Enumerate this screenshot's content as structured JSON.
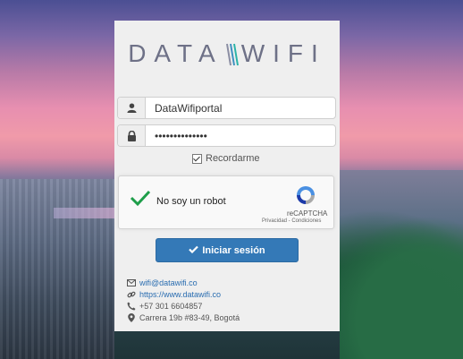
{
  "brand": {
    "logo_left": "DATA",
    "logo_right": "WIFI"
  },
  "login": {
    "username_value": "DataWifiportal",
    "password_value": "••••••••••••••",
    "remember_label": "Recordarme",
    "submit_label": "Iniciar sesión"
  },
  "captcha": {
    "label": "No soy un robot",
    "brand": "reCAPTCHA",
    "links": "Privacidad - Condiciones"
  },
  "contact": {
    "email": "wifi@datawifi.co",
    "website": "https://www.datawifi.co",
    "phone": "+57 301 6604857",
    "address": "Carrera 19b #83-49, Bogotá"
  },
  "colors": {
    "button": "#3479b7",
    "link": "#2a6db0",
    "check_green": "#1e9e4a",
    "logo": "#6e7187"
  },
  "icons": [
    "user-icon",
    "lock-icon",
    "checkmark-icon",
    "recaptcha-icon",
    "envelope-icon",
    "link-icon",
    "phone-icon",
    "map-marker-icon"
  ]
}
